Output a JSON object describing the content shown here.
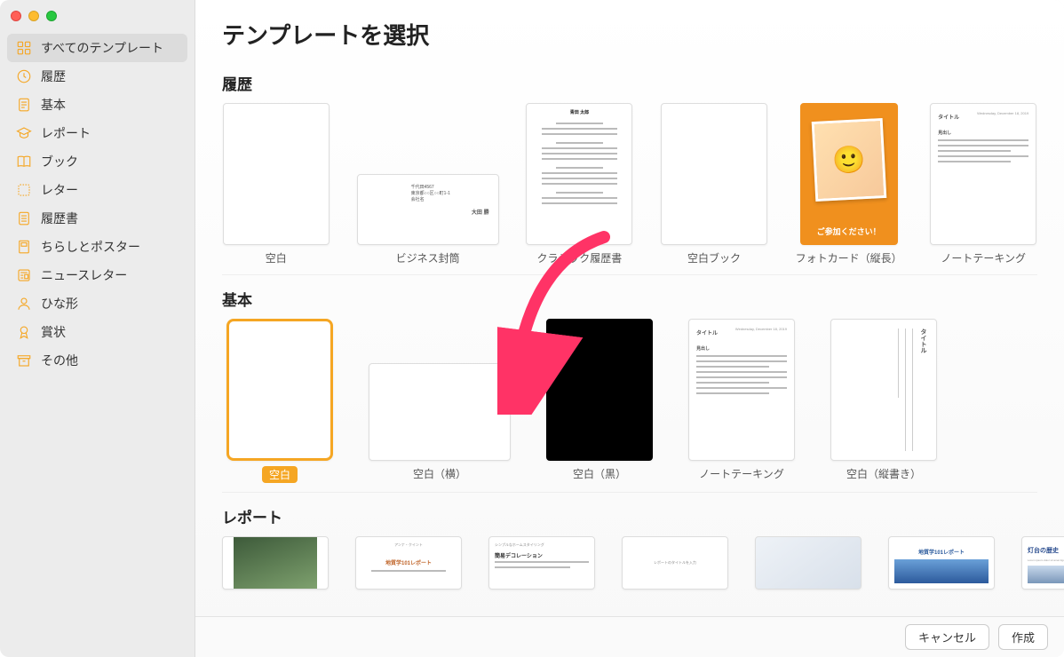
{
  "header": {
    "title": "テンプレートを選択"
  },
  "sidebar": {
    "items": [
      {
        "label": "すべてのテンプレート",
        "icon": "grid-icon",
        "active": true
      },
      {
        "label": "履歴",
        "icon": "clock-icon"
      },
      {
        "label": "基本",
        "icon": "document-icon"
      },
      {
        "label": "レポート",
        "icon": "mortarboard-icon"
      },
      {
        "label": "ブック",
        "icon": "book-icon"
      },
      {
        "label": "レター",
        "icon": "stamp-icon"
      },
      {
        "label": "履歴書",
        "icon": "list-icon"
      },
      {
        "label": "ちらしとポスター",
        "icon": "poster-icon"
      },
      {
        "label": "ニュースレター",
        "icon": "newsletter-icon"
      },
      {
        "label": "ひな形",
        "icon": "person-icon"
      },
      {
        "label": "賞状",
        "icon": "award-icon"
      },
      {
        "label": "その他",
        "icon": "archive-icon"
      }
    ]
  },
  "sections": {
    "recent": {
      "title": "履歴",
      "items": [
        {
          "label": "空白"
        },
        {
          "label": "ビジネス封筒"
        },
        {
          "label": "クラシック履歴書"
        },
        {
          "label": "空白ブック"
        },
        {
          "label": "フォトカード（縦長）",
          "photo_caption": "ご参加ください！"
        },
        {
          "label": "ノートテーキング",
          "thumb_title": "タイトル"
        }
      ]
    },
    "basic": {
      "title": "基本",
      "items": [
        {
          "label": "空白",
          "selected": true
        },
        {
          "label": "空白（横）"
        },
        {
          "label": "空白（黒）"
        },
        {
          "label": "ノートテーキング",
          "thumb_title": "タイトル"
        },
        {
          "label": "空白（縦書き）",
          "thumb_title": "タイトル"
        }
      ]
    },
    "report": {
      "title": "レポート",
      "items": [
        {
          "label": "",
          "thumb_title": ""
        },
        {
          "label": "",
          "thumb_title": "地質学101レポート"
        },
        {
          "label": "",
          "thumb_pre": "シンプルなホームスタイリング",
          "thumb_title": "簡易デコレーション"
        },
        {
          "label": "",
          "thumb_title": ""
        },
        {
          "label": "",
          "thumb_title": ""
        },
        {
          "label": "",
          "thumb_title": "地質学101レポート"
        },
        {
          "label": "",
          "thumb_title": "灯台の歴史"
        }
      ]
    }
  },
  "footer": {
    "cancel": "キャンセル",
    "create": "作成"
  },
  "misc": {
    "resume_heading": "青田 太郎",
    "note_date": "Wednesday, December 18, 2019"
  }
}
